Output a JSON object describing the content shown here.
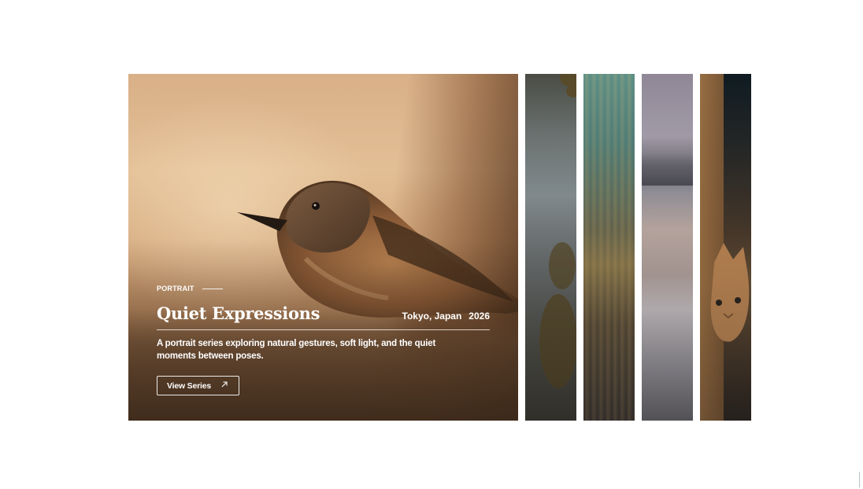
{
  "featured": {
    "category": "PORTRAIT",
    "title": "Quiet Expressions",
    "location": "Tokyo, Japan",
    "year": "2026",
    "description": "A portrait series exploring natural gestures, soft light, and the quiet moments between poses.",
    "button_label": "View Series",
    "button_icon": "arrow-up-right-icon"
  },
  "panels": [
    {
      "subject": "autumn-lake"
    },
    {
      "subject": "light-streaks"
    },
    {
      "subject": "winter-shore"
    },
    {
      "subject": "kitten"
    }
  ]
}
